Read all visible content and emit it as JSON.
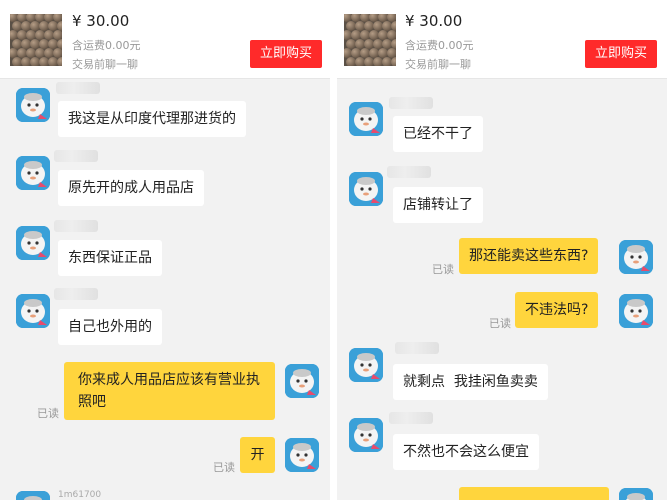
{
  "left": {
    "header": {
      "price": "¥ 30.00",
      "shipping": "含运费0.00元",
      "trade": "交易前聊一聊",
      "buy_label": "立即购买"
    },
    "messages": [
      {
        "side": "in",
        "text": "我这是从印度代理那进货的"
      },
      {
        "side": "in",
        "text": "原先开的成人用品店"
      },
      {
        "side": "in",
        "text": "东西保证正品"
      },
      {
        "side": "in",
        "text": "自己也外用的"
      },
      {
        "side": "out",
        "text": "你来成人用品店应该有营业执照吧",
        "read": "已读"
      },
      {
        "side": "out",
        "text": "开",
        "read": "已读"
      }
    ],
    "footer_nick": "1m61700"
  },
  "right": {
    "header": {
      "price": "¥ 30.00",
      "shipping": "含运费0.00元",
      "trade": "交易前聊一聊",
      "buy_label": "立即购买"
    },
    "messages": [
      {
        "side": "in",
        "text": "已经不干了"
      },
      {
        "side": "in",
        "text": "店铺转让了"
      },
      {
        "side": "out",
        "text": "那还能卖这些东西?",
        "read": "已读"
      },
      {
        "side": "out",
        "text": "不违法吗?",
        "read": "已读"
      },
      {
        "side": "in",
        "text": "就剩点  我挂闲鱼卖卖"
      },
      {
        "side": "in",
        "text": "不然也不会这么便宜"
      }
    ]
  }
}
